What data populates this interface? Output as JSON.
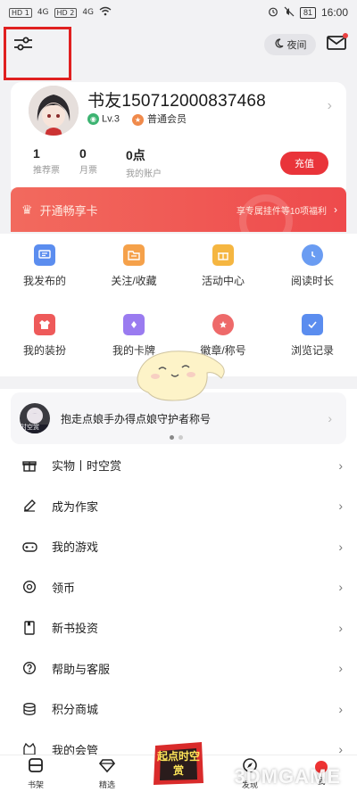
{
  "status_bar": {
    "sim1": "HD 1",
    "sim2": "HD 2",
    "network1": "4G",
    "network2": "4G",
    "battery": "81",
    "time": "16:00"
  },
  "topbar": {
    "night_label": "夜间"
  },
  "profile": {
    "username": "书友150712000837468",
    "level": "Lv.3",
    "membership": "普通会员",
    "stats": [
      {
        "value": "1",
        "label": "推荐票"
      },
      {
        "value": "0",
        "label": "月票"
      },
      {
        "value": "0点",
        "label": "我的账户"
      }
    ],
    "recharge_label": "充值"
  },
  "vip": {
    "title": "开通畅享卡",
    "subtitle": "享专属挂件等10项福利"
  },
  "grid": [
    {
      "label": "我发布的",
      "icon": "message-icon",
      "color": "#5b8def"
    },
    {
      "label": "关注/收藏",
      "icon": "folder-icon",
      "color": "#f5a14a"
    },
    {
      "label": "活动中心",
      "icon": "gift-icon",
      "color": "#f5b641"
    },
    {
      "label": "阅读时长",
      "icon": "clock-icon",
      "color": "#6a9cf2"
    },
    {
      "label": "我的装扮",
      "icon": "shirt-icon",
      "color": "#ee5a5a"
    },
    {
      "label": "我的卡牌",
      "icon": "card-icon",
      "color": "#9a7bf0"
    },
    {
      "label": "徽章/称号",
      "icon": "medal-icon",
      "color": "#ee6a6a"
    },
    {
      "label": "浏览记录",
      "icon": "history-icon",
      "color": "#5b8def"
    }
  ],
  "notice": {
    "avatar_text": "时空赏",
    "text": "抱走点娘手办得点娘守护者称号"
  },
  "menu": [
    {
      "label": "实物丨时空赏",
      "icon": "gift-box-icon"
    },
    {
      "label": "成为作家",
      "icon": "pen-icon"
    },
    {
      "label": "我的游戏",
      "icon": "gamepad-icon"
    },
    {
      "label": "领币",
      "icon": "coin-icon"
    },
    {
      "label": "新书投资",
      "icon": "book-invest-icon"
    },
    {
      "label": "帮助与客服",
      "icon": "help-icon"
    },
    {
      "label": "积分商城",
      "icon": "database-icon"
    },
    {
      "label": "我的会管",
      "icon": "cat-icon"
    }
  ],
  "bottom_nav": [
    {
      "label": "书架",
      "icon": "bookshelf-icon"
    },
    {
      "label": "精选",
      "icon": "diamond-icon"
    },
    {
      "label": "",
      "icon": "event-icon"
    },
    {
      "label": "发现",
      "icon": "compass-icon"
    },
    {
      "label": "我",
      "icon": "me-icon"
    }
  ],
  "overlay": {
    "event_text": "起点时空赏",
    "watermark": "3DMGAME"
  }
}
